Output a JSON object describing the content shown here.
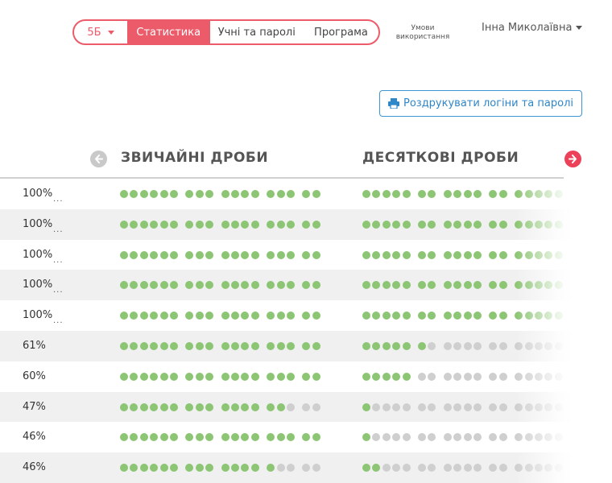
{
  "nav": {
    "class_label": "5Б",
    "tabs": [
      {
        "label": "Статистика",
        "active": true
      },
      {
        "label": "Учні та паролі",
        "active": false
      },
      {
        "label": "Програма",
        "active": false
      }
    ],
    "terms_line1": "Умови",
    "terms_line2": "використання",
    "user_name": "Інна Миколаївна"
  },
  "print_button": {
    "label": "Роздрукувати логіни та паролі",
    "icon": "printer-icon"
  },
  "sections": {
    "left_title": "ЗВИЧАЙНІ ДРОБИ",
    "right_title": "ДЕСЯТКОВІ ДРОБИ"
  },
  "colors": {
    "accent": "#ec5b69",
    "next_arrow": "#ec4159",
    "prev_arrow": "#c9c9c9",
    "dot_done": "#8cc573",
    "dot_todo": "#cfcfcf",
    "print_blue": "#3e95d1"
  },
  "groups_left": [
    6,
    3,
    4,
    3,
    2
  ],
  "groups_right": [
    5,
    2,
    4,
    2,
    5
  ],
  "students": [
    {
      "percent": "100%",
      "more": "...",
      "left_done": 18,
      "right_done": 18
    },
    {
      "percent": "100%",
      "more": "...",
      "left_done": 18,
      "right_done": 18
    },
    {
      "percent": "100%",
      "more": "...",
      "left_done": 18,
      "right_done": 18
    },
    {
      "percent": "100%",
      "more": "...",
      "left_done": 18,
      "right_done": 18
    },
    {
      "percent": "100%",
      "more": "...",
      "left_done": 18,
      "right_done": 18
    },
    {
      "percent": "61%",
      "more": "",
      "left_done": 18,
      "right_done": 6
    },
    {
      "percent": "60%",
      "more": "",
      "left_done": 18,
      "right_done": 5
    },
    {
      "percent": "47%",
      "more": "",
      "left_done": 15,
      "right_done": 1
    },
    {
      "percent": "46%",
      "more": "",
      "left_done": 18,
      "right_done": 1
    },
    {
      "percent": "46%",
      "more": "",
      "left_done": 14,
      "right_done": 2
    }
  ]
}
